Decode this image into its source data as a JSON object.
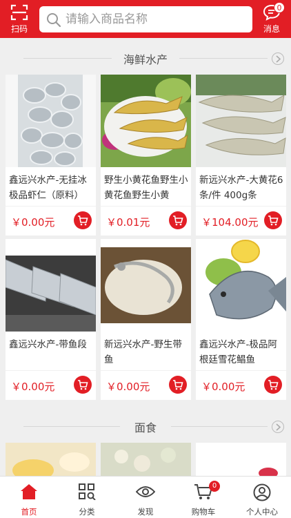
{
  "header": {
    "scan_label": "扫码",
    "search_placeholder": "请输入商品名称",
    "message_label": "消息",
    "message_count": "0"
  },
  "sections": [
    {
      "title": "海鲜水产",
      "products": [
        {
          "name": "鑫远兴水产-无挂冰极品虾仁（原料）",
          "price": "￥0.00元"
        },
        {
          "name": "野生小黄花鱼野生小黄花鱼野生小黄",
          "price": "￥0.01元"
        },
        {
          "name": "新远兴水产-大黄花6条/件 400g条",
          "price": "￥104.00元"
        },
        {
          "name": "鑫远兴水产-带鱼段",
          "price": "￥0.00元"
        },
        {
          "name": "新远兴水产-野生带鱼",
          "price": "￥0.00元"
        },
        {
          "name": "鑫远兴水产-极品阿根廷雪花鲳鱼",
          "price": "￥0.00元"
        }
      ]
    },
    {
      "title": "面食",
      "products": []
    }
  ],
  "tabbar": {
    "items": [
      {
        "label": "首页",
        "icon": "home-icon"
      },
      {
        "label": "分类",
        "icon": "category-icon"
      },
      {
        "label": "发现",
        "icon": "eye-icon"
      },
      {
        "label": "购物车",
        "icon": "cart-icon",
        "badge": "0"
      },
      {
        "label": "个人中心",
        "icon": "user-icon"
      }
    ]
  },
  "colors": {
    "accent": "#e21e25",
    "background": "#efefef"
  }
}
